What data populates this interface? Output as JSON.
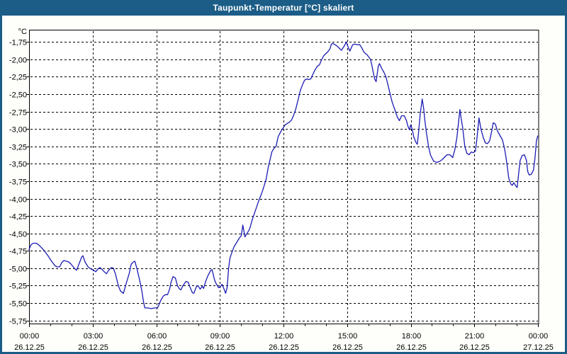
{
  "window": {
    "title": "Taupunkt-Temperatur [°C] skaliert",
    "frame_color": "#1b5d87",
    "title_text_color": "#ffffff",
    "background_color": "#fefefb"
  },
  "chart_data": {
    "type": "line",
    "title": "Taupunkt-Temperatur [°C] skaliert",
    "ylabel": "°C",
    "ylim": [
      -5.75,
      -1.75
    ],
    "y_tick_step": 0.25,
    "y_tick_labels": [
      "-1,75",
      "-2,00",
      "-2,25",
      "-2,50",
      "-2,75",
      "-3,00",
      "-3,25",
      "-3,50",
      "-3,75",
      "-4,00",
      "-4,25",
      "-4,50",
      "-4,75",
      "-5,00",
      "-5,25",
      "-5,50",
      "-5,75"
    ],
    "xlim_hours": [
      0,
      24
    ],
    "x_ticks": [
      {
        "hour": 0,
        "time": "00:00",
        "date": "26.12.25"
      },
      {
        "hour": 3,
        "time": "03:00",
        "date": "26.12.25"
      },
      {
        "hour": 6,
        "time": "06:00",
        "date": "26.12.25"
      },
      {
        "hour": 9,
        "time": "09:00",
        "date": "26.12.25"
      },
      {
        "hour": 12,
        "time": "12:00",
        "date": "26.12.25"
      },
      {
        "hour": 15,
        "time": "15:00",
        "date": "26.12.25"
      },
      {
        "hour": 18,
        "time": "18:00",
        "date": "26.12.25"
      },
      {
        "hour": 21,
        "time": "21:00",
        "date": "26.12.25"
      },
      {
        "hour": 24,
        "time": "00:00",
        "date": "27.12.25"
      }
    ],
    "grid": "dashed-black",
    "legend": "none",
    "line_color": "#1c1cb4",
    "axis_color": "#000000",
    "series": [
      {
        "name": "Taupunkt-Temperatur",
        "points": [
          [
            0.0,
            -4.73
          ],
          [
            0.1,
            -4.66
          ],
          [
            0.2,
            -4.64
          ],
          [
            0.33,
            -4.64
          ],
          [
            0.44,
            -4.66
          ],
          [
            0.57,
            -4.7
          ],
          [
            0.7,
            -4.74
          ],
          [
            0.87,
            -4.81
          ],
          [
            1.04,
            -4.89
          ],
          [
            1.21,
            -4.96
          ],
          [
            1.31,
            -4.98
          ],
          [
            1.44,
            -4.98
          ],
          [
            1.54,
            -4.92
          ],
          [
            1.64,
            -4.89
          ],
          [
            1.77,
            -4.9
          ],
          [
            1.87,
            -4.91
          ],
          [
            1.98,
            -4.94
          ],
          [
            2.11,
            -4.99
          ],
          [
            2.24,
            -5.03
          ],
          [
            2.38,
            -4.92
          ],
          [
            2.48,
            -4.84
          ],
          [
            2.54,
            -4.82
          ],
          [
            2.64,
            -4.91
          ],
          [
            2.78,
            -4.98
          ],
          [
            2.91,
            -5.01
          ],
          [
            3.05,
            -5.03
          ],
          [
            3.15,
            -5.05
          ],
          [
            3.25,
            -5.01
          ],
          [
            3.35,
            -4.99
          ],
          [
            3.48,
            -5.03
          ],
          [
            3.58,
            -5.06
          ],
          [
            3.65,
            -5.08
          ],
          [
            3.75,
            -5.03
          ],
          [
            3.88,
            -4.99
          ],
          [
            3.98,
            -5.0
          ],
          [
            4.08,
            -5.09
          ],
          [
            4.22,
            -5.26
          ],
          [
            4.32,
            -5.33
          ],
          [
            4.45,
            -5.36
          ],
          [
            4.59,
            -5.21
          ],
          [
            4.72,
            -5.08
          ],
          [
            4.82,
            -4.94
          ],
          [
            4.92,
            -4.91
          ],
          [
            4.99,
            -4.9
          ],
          [
            5.09,
            -5.01
          ],
          [
            5.22,
            -5.18
          ],
          [
            5.32,
            -5.33
          ],
          [
            5.39,
            -5.47
          ],
          [
            5.46,
            -5.57
          ],
          [
            5.59,
            -5.57
          ],
          [
            5.76,
            -5.58
          ],
          [
            5.93,
            -5.57
          ],
          [
            6.06,
            -5.57
          ],
          [
            6.13,
            -5.52
          ],
          [
            6.23,
            -5.45
          ],
          [
            6.33,
            -5.4
          ],
          [
            6.43,
            -5.38
          ],
          [
            6.53,
            -5.38
          ],
          [
            6.63,
            -5.3
          ],
          [
            6.69,
            -5.21
          ],
          [
            6.79,
            -5.12
          ],
          [
            6.9,
            -5.14
          ],
          [
            7.0,
            -5.25
          ],
          [
            7.1,
            -5.3
          ],
          [
            7.16,
            -5.31
          ],
          [
            7.26,
            -5.25
          ],
          [
            7.4,
            -5.19
          ],
          [
            7.5,
            -5.2
          ],
          [
            7.6,
            -5.28
          ],
          [
            7.7,
            -5.35
          ],
          [
            7.77,
            -5.36
          ],
          [
            7.9,
            -5.26
          ],
          [
            7.97,
            -5.25
          ],
          [
            8.07,
            -5.3
          ],
          [
            8.17,
            -5.26
          ],
          [
            8.23,
            -5.29
          ],
          [
            8.33,
            -5.19
          ],
          [
            8.43,
            -5.11
          ],
          [
            8.57,
            -5.03
          ],
          [
            8.63,
            -5.02
          ],
          [
            8.74,
            -5.16
          ],
          [
            8.8,
            -5.21
          ],
          [
            8.94,
            -5.28
          ],
          [
            9.04,
            -5.26
          ],
          [
            9.1,
            -5.23
          ],
          [
            9.2,
            -5.3
          ],
          [
            9.27,
            -5.36
          ],
          [
            9.34,
            -5.28
          ],
          [
            9.41,
            -5.01
          ],
          [
            9.47,
            -4.86
          ],
          [
            9.57,
            -4.77
          ],
          [
            9.67,
            -4.69
          ],
          [
            9.81,
            -4.62
          ],
          [
            9.91,
            -4.57
          ],
          [
            10.01,
            -4.53
          ],
          [
            10.08,
            -4.38
          ],
          [
            10.18,
            -4.55
          ],
          [
            10.28,
            -4.5
          ],
          [
            10.38,
            -4.45
          ],
          [
            10.44,
            -4.4
          ],
          [
            10.51,
            -4.32
          ],
          [
            10.61,
            -4.23
          ],
          [
            10.71,
            -4.14
          ],
          [
            10.81,
            -4.05
          ],
          [
            10.91,
            -3.97
          ],
          [
            11.01,
            -3.89
          ],
          [
            11.11,
            -3.79
          ],
          [
            11.18,
            -3.72
          ],
          [
            11.28,
            -3.55
          ],
          [
            11.38,
            -3.42
          ],
          [
            11.45,
            -3.33
          ],
          [
            11.55,
            -3.28
          ],
          [
            11.65,
            -3.25
          ],
          [
            11.75,
            -3.11
          ],
          [
            11.85,
            -3.05
          ],
          [
            11.95,
            -3.0
          ],
          [
            12.08,
            -2.94
          ],
          [
            12.18,
            -2.92
          ],
          [
            12.28,
            -2.9
          ],
          [
            12.38,
            -2.87
          ],
          [
            12.48,
            -2.8
          ],
          [
            12.58,
            -2.71
          ],
          [
            12.69,
            -2.58
          ],
          [
            12.79,
            -2.45
          ],
          [
            12.89,
            -2.37
          ],
          [
            12.99,
            -2.3
          ],
          [
            13.09,
            -2.28
          ],
          [
            13.19,
            -2.29
          ],
          [
            13.29,
            -2.28
          ],
          [
            13.39,
            -2.21
          ],
          [
            13.49,
            -2.15
          ],
          [
            13.59,
            -2.1
          ],
          [
            13.69,
            -2.08
          ],
          [
            13.79,
            -2.01
          ],
          [
            13.89,
            -1.95
          ],
          [
            13.99,
            -1.92
          ],
          [
            14.09,
            -1.89
          ],
          [
            14.19,
            -1.85
          ],
          [
            14.26,
            -1.78
          ],
          [
            14.33,
            -1.77
          ],
          [
            14.43,
            -1.79
          ],
          [
            14.53,
            -1.81
          ],
          [
            14.63,
            -1.84
          ],
          [
            14.73,
            -1.87
          ],
          [
            14.86,
            -1.81
          ],
          [
            14.96,
            -1.75
          ],
          [
            15.06,
            -1.83
          ],
          [
            15.13,
            -1.88
          ],
          [
            15.26,
            -1.79
          ],
          [
            15.36,
            -1.78
          ],
          [
            15.5,
            -1.79
          ],
          [
            15.6,
            -1.79
          ],
          [
            15.7,
            -1.84
          ],
          [
            15.8,
            -1.9
          ],
          [
            15.93,
            -1.93
          ],
          [
            16.03,
            -1.97
          ],
          [
            16.1,
            -2.0
          ],
          [
            16.17,
            -2.09
          ],
          [
            16.23,
            -2.18
          ],
          [
            16.3,
            -2.28
          ],
          [
            16.37,
            -2.32
          ],
          [
            16.47,
            -2.1
          ],
          [
            16.53,
            -2.06
          ],
          [
            16.63,
            -2.13
          ],
          [
            16.73,
            -2.18
          ],
          [
            16.83,
            -2.25
          ],
          [
            16.93,
            -2.37
          ],
          [
            17.03,
            -2.5
          ],
          [
            17.13,
            -2.62
          ],
          [
            17.27,
            -2.74
          ],
          [
            17.37,
            -2.83
          ],
          [
            17.47,
            -2.88
          ],
          [
            17.57,
            -2.81
          ],
          [
            17.7,
            -2.81
          ],
          [
            17.8,
            -2.88
          ],
          [
            17.87,
            -2.96
          ],
          [
            17.94,
            -3.01
          ],
          [
            18.0,
            -2.94
          ],
          [
            18.07,
            -3.0
          ],
          [
            18.14,
            -3.11
          ],
          [
            18.24,
            -3.19
          ],
          [
            18.31,
            -3.22
          ],
          [
            18.37,
            -3.05
          ],
          [
            18.44,
            -2.8
          ],
          [
            18.54,
            -2.57
          ],
          [
            18.61,
            -2.7
          ],
          [
            18.67,
            -2.88
          ],
          [
            18.74,
            -3.05
          ],
          [
            18.84,
            -3.25
          ],
          [
            18.94,
            -3.38
          ],
          [
            19.08,
            -3.46
          ],
          [
            19.21,
            -3.48
          ],
          [
            19.34,
            -3.47
          ],
          [
            19.48,
            -3.44
          ],
          [
            19.61,
            -3.4
          ],
          [
            19.71,
            -3.37
          ],
          [
            19.85,
            -3.37
          ],
          [
            19.98,
            -3.41
          ],
          [
            20.08,
            -3.3
          ],
          [
            20.18,
            -3.12
          ],
          [
            20.32,
            -2.72
          ],
          [
            20.38,
            -2.85
          ],
          [
            20.45,
            -2.98
          ],
          [
            20.55,
            -3.25
          ],
          [
            20.65,
            -3.35
          ],
          [
            20.75,
            -3.37
          ],
          [
            20.85,
            -3.33
          ],
          [
            20.95,
            -3.34
          ],
          [
            21.05,
            -3.32
          ],
          [
            21.12,
            -3.15
          ],
          [
            21.22,
            -2.84
          ],
          [
            21.32,
            -3.01
          ],
          [
            21.42,
            -3.12
          ],
          [
            21.52,
            -3.2
          ],
          [
            21.62,
            -3.21
          ],
          [
            21.72,
            -3.17
          ],
          [
            21.82,
            -3.03
          ],
          [
            21.89,
            -2.91
          ],
          [
            21.99,
            -2.93
          ],
          [
            22.09,
            -3.03
          ],
          [
            22.22,
            -3.1
          ],
          [
            22.32,
            -3.15
          ],
          [
            22.42,
            -3.27
          ],
          [
            22.49,
            -3.4
          ],
          [
            22.56,
            -3.55
          ],
          [
            22.62,
            -3.7
          ],
          [
            22.72,
            -3.79
          ],
          [
            22.79,
            -3.81
          ],
          [
            22.86,
            -3.77
          ],
          [
            22.96,
            -3.82
          ],
          [
            23.02,
            -3.84
          ],
          [
            23.09,
            -3.64
          ],
          [
            23.16,
            -3.45
          ],
          [
            23.26,
            -3.38
          ],
          [
            23.36,
            -3.37
          ],
          [
            23.46,
            -3.45
          ],
          [
            23.52,
            -3.61
          ],
          [
            23.59,
            -3.66
          ],
          [
            23.69,
            -3.65
          ],
          [
            23.79,
            -3.59
          ],
          [
            23.86,
            -3.42
          ],
          [
            23.93,
            -3.17
          ],
          [
            23.99,
            -3.1
          ]
        ]
      }
    ]
  }
}
